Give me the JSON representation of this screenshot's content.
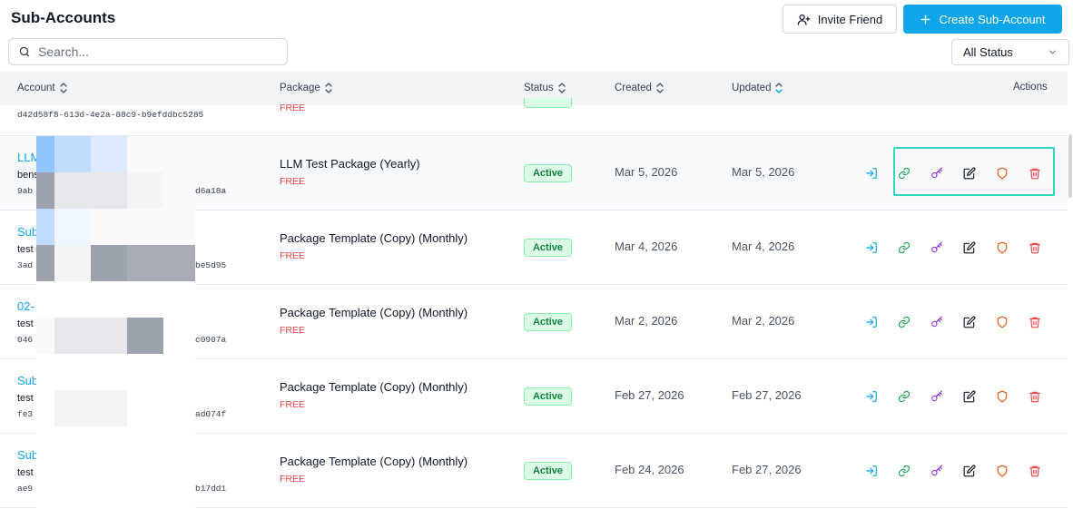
{
  "header": {
    "title": "Sub-Accounts",
    "invite_label": "Invite Friend",
    "create_label": "Create Sub-Account"
  },
  "search": {
    "placeholder": "Search...",
    "value": ""
  },
  "status_filter": {
    "selected": "All Status"
  },
  "table": {
    "columns": {
      "account": "Account",
      "package": "Package",
      "status": "Status",
      "created": "Created",
      "updated": "Updated",
      "actions": "Actions"
    },
    "partial_row": {
      "id": "d42d58f8-613d-4e2a-88c9-b9efddbc5285",
      "tier": "FREE"
    },
    "rows": [
      {
        "name": "LLM",
        "email": "bens",
        "id_start": "9ab",
        "id_end": "d6a18a",
        "package": "LLM Test Package (Yearly)",
        "tier": "FREE",
        "status": "Active",
        "created": "Mar 5, 2026",
        "updated": "Mar 5, 2026"
      },
      {
        "name": "Sub",
        "email": "test",
        "id_start": "3ad",
        "id_end": "be5d95",
        "package": "Package Template (Copy) (Monthly)",
        "tier": "FREE",
        "status": "Active",
        "created": "Mar 4, 2026",
        "updated": "Mar 4, 2026"
      },
      {
        "name": "02-",
        "email": "test",
        "id_start": "046",
        "id_end": "c0907a",
        "package": "Package Template (Copy) (Monthly)",
        "tier": "FREE",
        "status": "Active",
        "created": "Mar 2, 2026",
        "updated": "Mar 2, 2026"
      },
      {
        "name": "Sub",
        "email": "test",
        "id_start": "fe3",
        "id_end": "ad074f",
        "package": "Package Template (Copy) (Monthly)",
        "tier": "FREE",
        "status": "Active",
        "created": "Feb 27, 2026",
        "updated": "Feb 27, 2026"
      },
      {
        "name": "Sub",
        "email": "test",
        "id_start": "ae9",
        "id_end": "b17dd1",
        "package": "Package Template (Copy) (Monthly)",
        "tier": "FREE",
        "status": "Active",
        "created": "Feb 24, 2026",
        "updated": "Feb 27, 2026"
      }
    ]
  },
  "colors": {
    "accent": "#0ea5e9",
    "active_badge": "#dcfce7",
    "free_tag": "#ef4444",
    "focus_ring": "#2dd4bf",
    "action_login": "#0ea5e9",
    "action_link": "#16a34a",
    "action_key": "#9333ea",
    "action_edit": "#111827",
    "action_shield": "#ea580c",
    "action_delete": "#ef4444"
  },
  "icons": [
    "user-plus-icon",
    "plus-icon",
    "search-icon",
    "chevron-down-icon",
    "sort-icon",
    "login-icon",
    "link-icon",
    "key-icon",
    "edit-icon",
    "shield-icon",
    "trash-icon"
  ]
}
